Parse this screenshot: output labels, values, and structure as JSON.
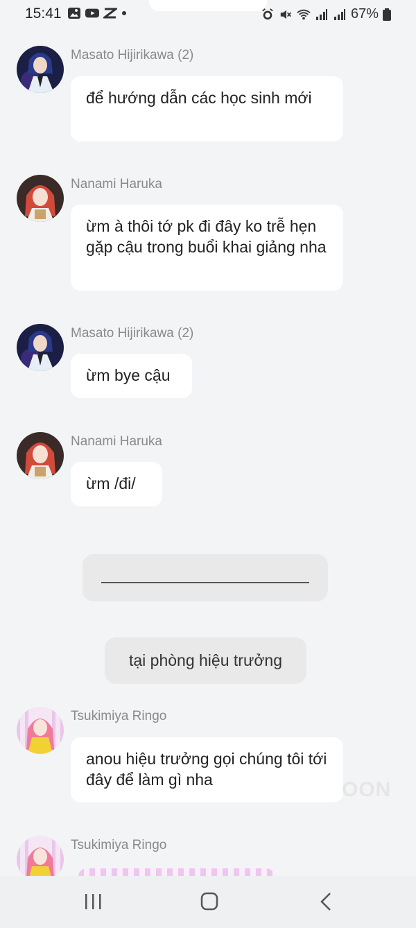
{
  "status_bar": {
    "time": "15:41",
    "battery": "67%"
  },
  "messages": [
    {
      "sender": "Masato Hijirikawa (2)",
      "text": "để hướng dẫn các học sinh mới"
    },
    {
      "sender": "Nanami Haruka",
      "text": "ừm à thôi tớ pk đi đây ko trễ hẹn gặp cậu trong buổi khai giảng nha"
    },
    {
      "sender": "Masato Hijirikawa (2)",
      "text": "ừm bye cậu"
    },
    {
      "sender": "Nanami Haruka",
      "text": "ừm /đi/"
    },
    {
      "sender": "Tsukimiya Ringo",
      "text": "anou hiệu trưởng gọi chúng tôi tới đây để làm gì nha"
    },
    {
      "sender": "Tsukimiya Ringo",
      "text": ""
    }
  ],
  "narration": {
    "scene": "tại phòng hiệu trưởng"
  },
  "watermark": "OON",
  "icons": {
    "nav": [
      "recents-icon",
      "home-icon",
      "back-icon"
    ],
    "status_left": [
      "gallery-icon",
      "youtube-icon",
      "capcut-icon",
      "dot-icon"
    ],
    "status_right": [
      "alarm-icon",
      "mute-icon",
      "wifi-icon",
      "signal-icon",
      "signal-icon",
      "battery-icon"
    ]
  }
}
